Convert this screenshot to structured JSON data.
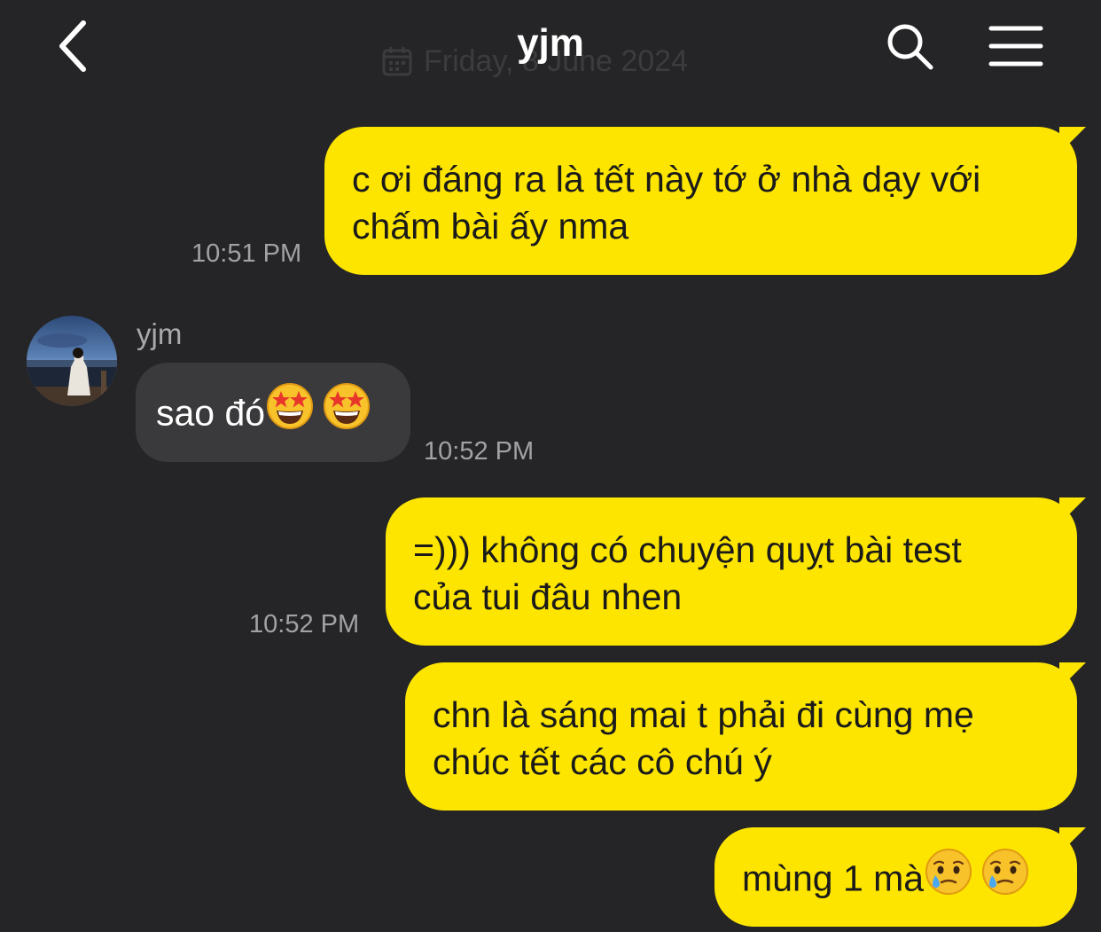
{
  "header": {
    "title": "yjm",
    "date_label": "Friday, 8 June 2024",
    "back_icon": "chevron-left-icon",
    "search_icon": "search-icon",
    "menu_icon": "menu-icon"
  },
  "colors": {
    "background": "#252527",
    "outgoing_bubble": "#fde500",
    "incoming_bubble": "#3a3a3c",
    "timestamp": "#a2a2a6"
  },
  "messages": [
    {
      "direction": "outgoing",
      "lines": [
        "c ơi đáng ra là tết này tớ ở nhà dạy với",
        "chấm bài ấy nma"
      ],
      "time": "10:51 PM"
    },
    {
      "direction": "incoming",
      "sender": "yjm",
      "text": "sao đó",
      "emoji": [
        "star-struck-emoji",
        "star-struck-emoji"
      ],
      "time": "10:52 PM"
    },
    {
      "direction": "outgoing",
      "lines": [
        "=))) không có chuyện quỵt bài test",
        "của tui đâu nhen"
      ],
      "time": "10:52 PM"
    },
    {
      "direction": "outgoing",
      "lines": [
        "chn là sáng mai t phải đi cùng mẹ",
        "chúc tết các cô chú ý"
      ]
    },
    {
      "direction": "outgoing",
      "text": "mùng 1 mà",
      "emoji": [
        "holding-back-tears-emoji",
        "holding-back-tears-emoji"
      ]
    }
  ]
}
